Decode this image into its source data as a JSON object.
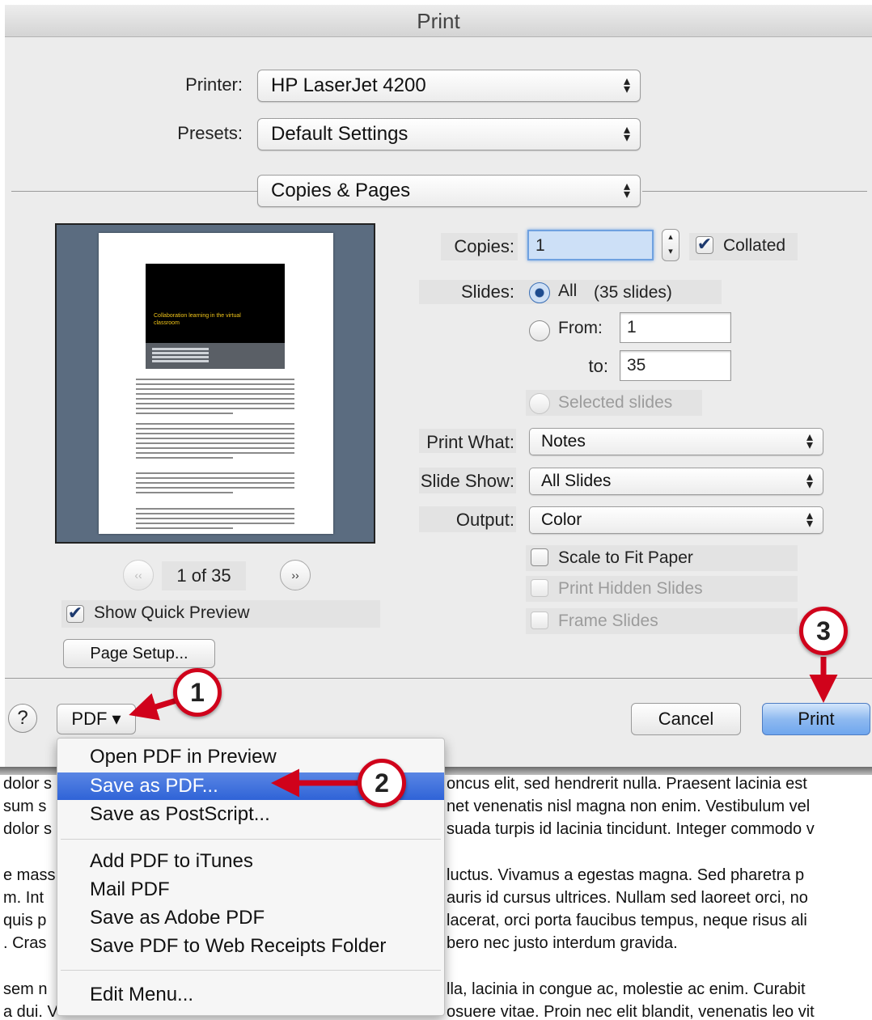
{
  "window": {
    "title": "Print"
  },
  "printer": {
    "label": "Printer:",
    "value": "HP LaserJet 4200"
  },
  "presets": {
    "label": "Presets:",
    "value": "Default Settings"
  },
  "section": {
    "value": "Copies & Pages"
  },
  "preview": {
    "slide_title": "Collaboration learning in the virtual classroom",
    "page_indicator": "1 of 35",
    "show_quick_preview": {
      "label": "Show Quick Preview",
      "checked": true
    },
    "page_setup_label": "Page Setup..."
  },
  "copies": {
    "label": "Copies:",
    "value": "1",
    "collated_label": "Collated",
    "collated": true
  },
  "slides": {
    "label": "Slides:",
    "all_label": "All",
    "all_count": "(35 slides)",
    "from_label": "From:",
    "from_value": "1",
    "to_label": "to:",
    "to_value": "35",
    "selected_label": "Selected slides"
  },
  "print_what": {
    "label": "Print What:",
    "value": "Notes"
  },
  "slide_show": {
    "label": "Slide Show:",
    "value": "All Slides"
  },
  "output": {
    "label": "Output:",
    "value": "Color"
  },
  "options": {
    "scale_to_fit": "Scale to Fit Paper",
    "print_hidden": "Print Hidden Slides",
    "frame_slides": "Frame Slides"
  },
  "footer": {
    "help": "?",
    "pdf_label": "PDF ▾",
    "cancel_label": "Cancel",
    "print_label": "Print"
  },
  "pdf_menu": {
    "items": [
      "Open PDF in Preview",
      "Save as PDF...",
      "Save as PostScript...",
      "Add PDF to iTunes",
      "Mail PDF",
      "Save as Adobe PDF",
      "Save PDF to Web Receipts Folder",
      "Edit Menu..."
    ],
    "highlighted_index": 1
  },
  "callouts": [
    "1",
    "2",
    "3"
  ],
  "background_doc": {
    "left": [
      "dolor s",
      "sum s",
      "dolor s",
      "e mass",
      "m. Int",
      "quis p",
      ". Cras",
      "sem n",
      "a dui. V"
    ],
    "right": [
      "oncus elit, sed hendrerit nulla. Praesent lacinia est",
      "net venenatis nisl magna non enim. Vestibulum vel",
      "suada turpis id lacinia tincidunt. Integer commodo v",
      "luctus. Vivamus a egestas magna. Sed pharetra p",
      "auris id cursus ultrices. Nullam sed laoreet orci, no",
      "lacerat, orci porta faucibus tempus, neque risus ali",
      "bero nec justo interdum gravida.",
      "lla, lacinia in congue ac, molestie ac enim. Curabit",
      "osuere vitae. Proin nec elit blandit, venenatis leo vit"
    ]
  },
  "colors": {
    "accent": "#2f63d7",
    "callout_red": "#d0021b",
    "preview_bg": "#5b6c80"
  }
}
